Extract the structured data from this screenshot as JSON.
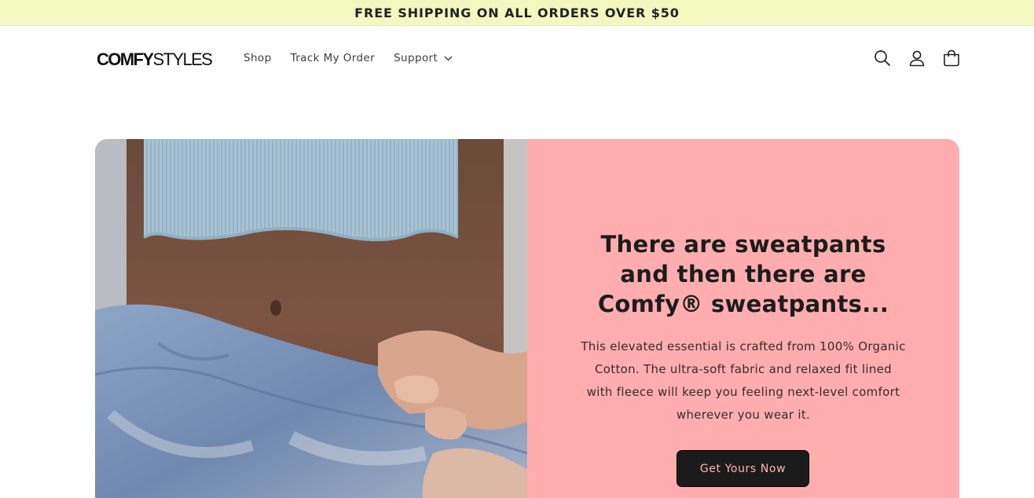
{
  "announcement": {
    "text": "FREE SHIPPING ON ALL ORDERS OVER $50"
  },
  "header": {
    "logo_bold": "COMFY",
    "logo_light": "STYLES",
    "nav": [
      {
        "label": "Shop"
      },
      {
        "label": "Track My Order"
      },
      {
        "label": "Support"
      }
    ],
    "icons": [
      "search-icon",
      "account-icon",
      "cart-icon"
    ]
  },
  "hero": {
    "title": "There are sweatpants and then there are Comfy® sweatpants...",
    "description": "This elevated essential is crafted from 100% Organic Cotton. The ultra-soft fabric and relaxed fit lined with fleece will keep you feeling next-level comfort wherever you wear it.",
    "cta_label": "Get Yours Now",
    "panel_color": "#ffadae",
    "media_icon": "product-video-image"
  },
  "colors": {
    "announcement_bg": "#f3f8c0",
    "button_bg": "#1b1b1b",
    "button_text": "#ffb3b3"
  }
}
